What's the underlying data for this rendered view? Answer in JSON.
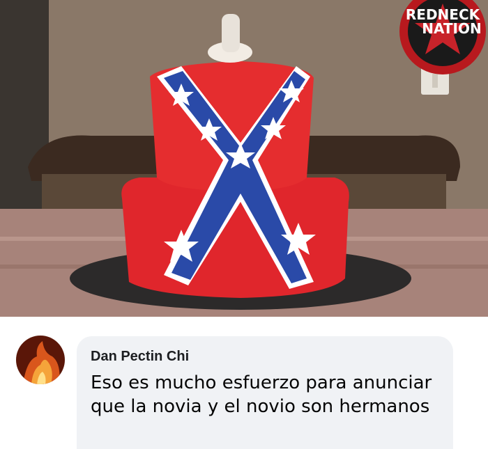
{
  "photo": {
    "watermark_line1": "REDNECK",
    "watermark_line2": "NATION"
  },
  "comment": {
    "author": "Dan Pectin Chi",
    "text": "Eso es mucho esfuerzo para anunciar que la novia y el novio son hermanos"
  },
  "colors": {
    "cake_red": "#e0262c",
    "cross_blue": "#2a4aa8",
    "bubble_bg": "#f0f2f5"
  }
}
